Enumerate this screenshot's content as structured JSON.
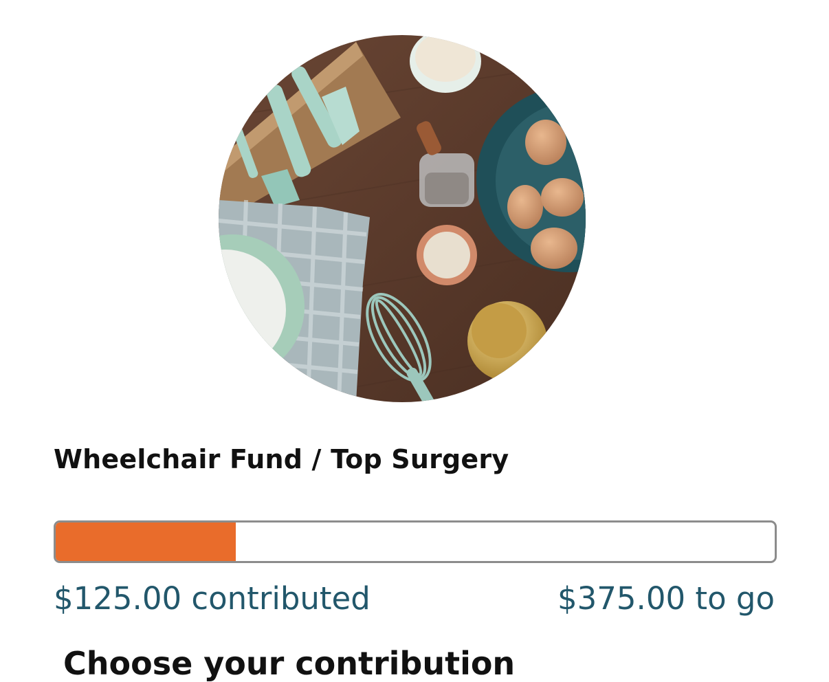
{
  "fund": {
    "title": "Wheelchair Fund / Top Surgery",
    "image_icon": "kitchen-tools-photo",
    "progress_fraction": 0.25,
    "contributed_label": "$125.00 contributed",
    "remaining_label": "$375.00 to go",
    "accent_color": "#e96c2b",
    "link_color": "#22576b"
  },
  "next_section": {
    "heading_partial": "Choose your contribution"
  }
}
